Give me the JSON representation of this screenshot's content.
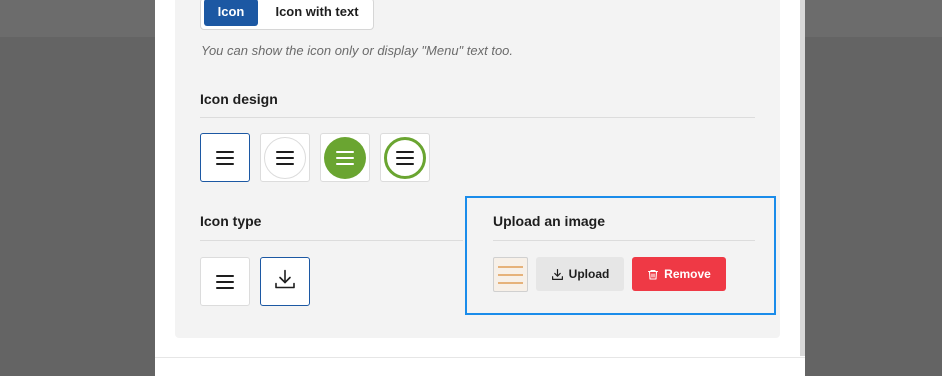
{
  "display_toggle": {
    "options": [
      "Icon",
      "Icon with text"
    ],
    "selected": "Icon",
    "hint": "You can show the icon only or display \"Menu\" text too."
  },
  "icon_design": {
    "title": "Icon design",
    "options": [
      {
        "name": "plain-hamburger",
        "selected": true
      },
      {
        "name": "outlined-circle-hamburger",
        "selected": false
      },
      {
        "name": "filled-green-circle-hamburger",
        "selected": false
      },
      {
        "name": "green-ring-hamburger",
        "selected": false
      }
    ],
    "accent_color": "#6aa531"
  },
  "icon_type": {
    "title": "Icon type",
    "options": [
      {
        "name": "hamburger-icon",
        "selected": false
      },
      {
        "name": "download-icon",
        "selected": true
      }
    ]
  },
  "upload": {
    "title": "Upload an image",
    "upload_label": "Upload",
    "remove_label": "Remove"
  },
  "colors": {
    "primary": "#1c58a3",
    "danger": "#ef3945",
    "highlight_border": "#1a8cea"
  }
}
